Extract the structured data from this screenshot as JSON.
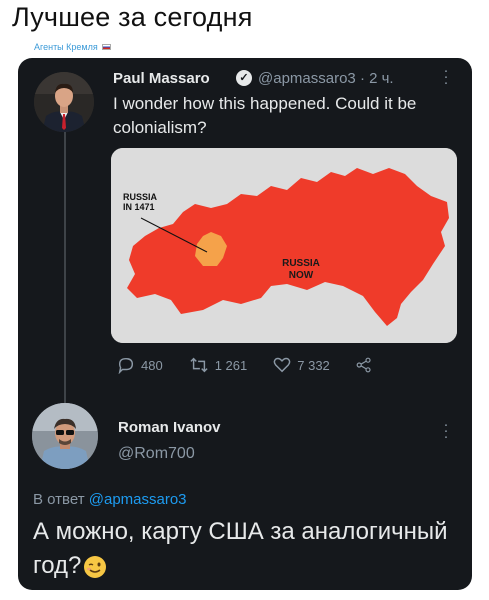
{
  "header": {
    "title": "Лучшее за сегодня",
    "channel": "Агенты Кремля"
  },
  "tweet": {
    "author_name": "Paul Massaro",
    "handle": "@apmassaro3 · 2 ч.",
    "text": "I wonder how this happened. Could it be colonialism?",
    "map": {
      "label_old_line1": "RUSSIA",
      "label_old_line2": "IN 1471",
      "label_now_line1": "RUSSIA",
      "label_now_line2": "NOW"
    },
    "stats": {
      "replies": "480",
      "retweets": "1 261",
      "likes": "7 332"
    },
    "colors": {
      "background": "#15181c",
      "map_red": "#ef3b2a",
      "map_orange": "#f5a24a"
    }
  },
  "reply": {
    "author_name": "Roman Ivanov",
    "handle": "@Rom700",
    "reply_prefix": "В ответ",
    "reply_handle": "@apmassaro3",
    "text": "А можно, карту США за аналогичный год?"
  }
}
